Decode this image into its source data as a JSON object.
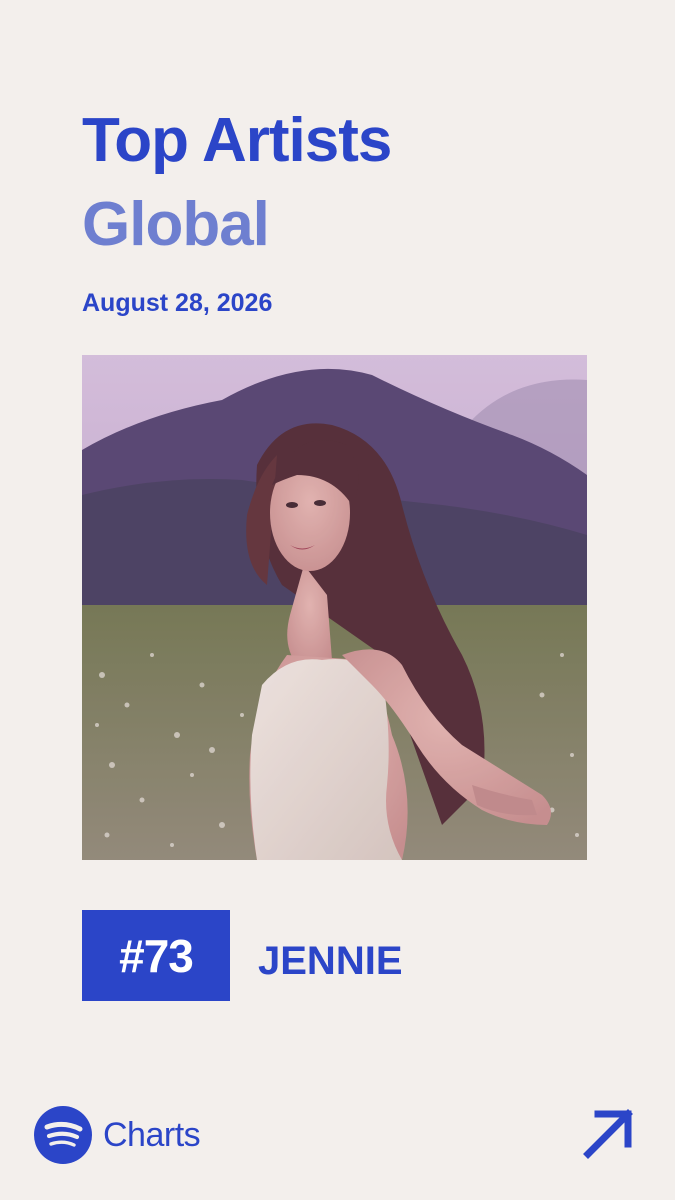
{
  "header": {
    "title": "Top Artists",
    "region": "Global",
    "date": "August 28, 2026"
  },
  "entry": {
    "rank": "#73",
    "artist": "JENNIE",
    "image_description": "artist-photo"
  },
  "footer": {
    "brand_label": "Charts",
    "brand_icon": "spotify-logo-icon",
    "link_icon": "arrow-up-right-icon"
  },
  "colors": {
    "accent": "#2B45C8",
    "accent_light": "#6E7FD0",
    "background": "#F3EFEC",
    "rank_text": "#FFFFFF"
  }
}
